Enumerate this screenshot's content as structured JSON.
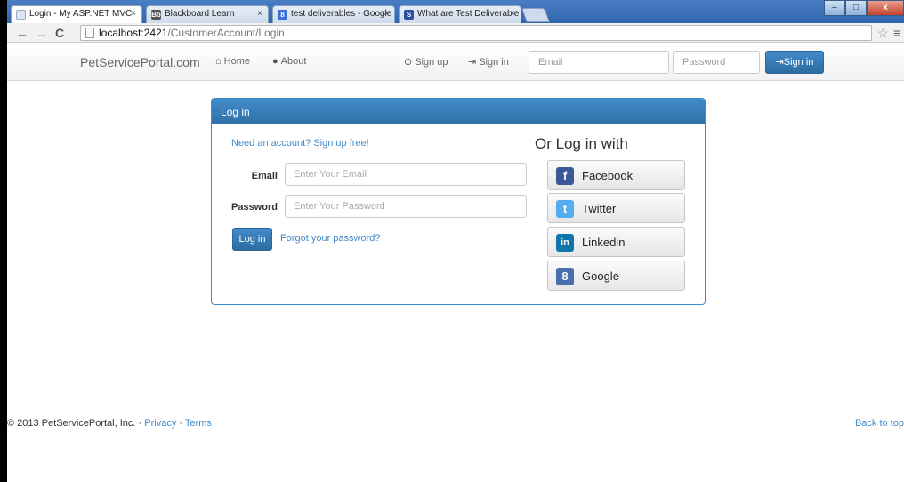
{
  "browser": {
    "tabs": [
      {
        "title": "Login - My ASP.NET MVC",
        "favicon": "page-icon"
      },
      {
        "title": "Blackboard Learn",
        "favicon": "blackboard-icon"
      },
      {
        "title": "test deliverables - Google",
        "favicon": "google-icon"
      },
      {
        "title": "What are Test Deliverable",
        "favicon": "stm-icon"
      }
    ],
    "tab_close": "×",
    "url_host": "localhost:2421",
    "url_path": "/CustomerAccount/Login",
    "win_min": "–",
    "win_max": "□",
    "win_close": "x"
  },
  "navbar": {
    "brand": "PetServicePortal.com",
    "home": "Home",
    "about": "About",
    "signup": "Sign up",
    "signin": "Sign in",
    "email_placeholder": "Email",
    "password_placeholder": "Password",
    "signin_button": "Sign in"
  },
  "login": {
    "heading": "Log in",
    "signup_link": "Need an account? Sign up free!",
    "email_label": "Email",
    "email_placeholder": "Enter Your Email",
    "password_label": "Password",
    "password_placeholder": "Enter Your Password",
    "login_button": "Log in",
    "forgot_link": "Forgot your password?",
    "social_title": "Or Log in with",
    "social": [
      {
        "label": "Facebook",
        "glyph": "f",
        "color": "#3b5998"
      },
      {
        "label": "Twitter",
        "glyph": "t",
        "color": "#55acee"
      },
      {
        "label": "Linkedin",
        "glyph": "in",
        "color": "#0e76a8"
      },
      {
        "label": "Google",
        "glyph": "8",
        "color": "#4a6fae"
      }
    ]
  },
  "footer": {
    "copyright": "© 2013 PetServicePortal, Inc.",
    "sep": "·",
    "privacy": "Privacy",
    "terms": "Terms",
    "back_to_top": "Back to top"
  },
  "colors": {
    "primary": "#428bca",
    "titlebar": "#2f65ae"
  }
}
